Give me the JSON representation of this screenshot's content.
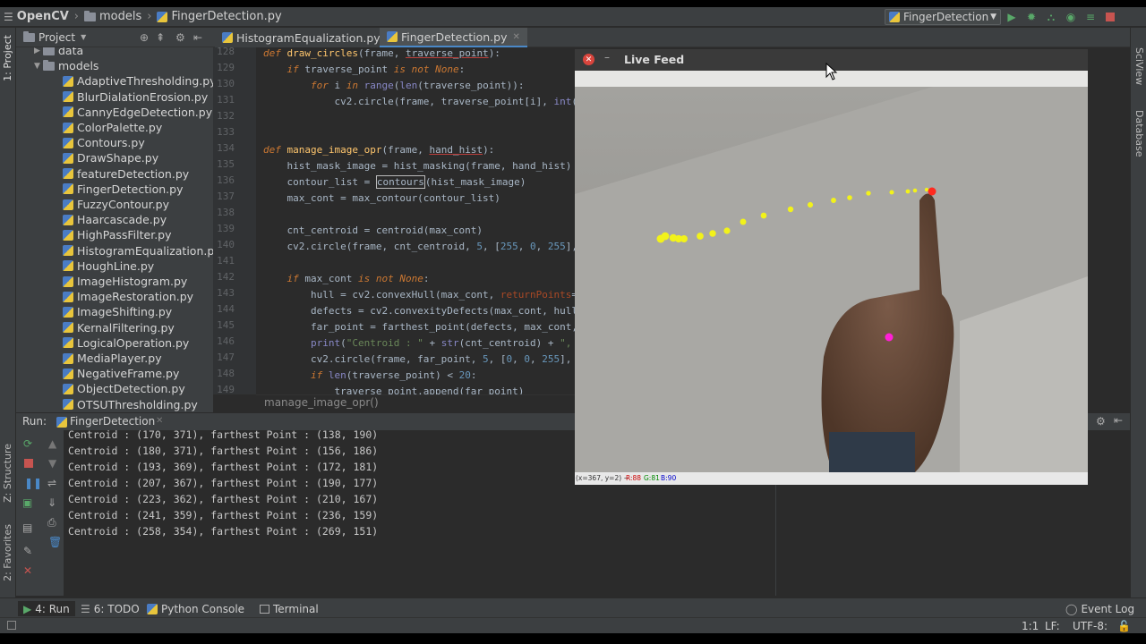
{
  "navbar": {
    "crumbs": [
      "OpenCV",
      "models",
      "FingerDetection.py"
    ],
    "run_config": "FingerDetection"
  },
  "left_strip": {
    "project_tab": "1: Project",
    "structure_tab": "Z: Structure",
    "favorites_tab": "2: Favorites"
  },
  "right_strip": {
    "sciview_tab": "SciView",
    "database_tab": "Database"
  },
  "project_panel": {
    "title": "Project",
    "items": [
      {
        "label": "data",
        "kind": "folder",
        "indent": 1
      },
      {
        "label": "models",
        "kind": "folder",
        "indent": 1
      },
      {
        "label": "AdaptiveThresholding.py",
        "kind": "file"
      },
      {
        "label": "BlurDialationErosion.py",
        "kind": "file"
      },
      {
        "label": "CannyEdgeDetection.py",
        "kind": "file"
      },
      {
        "label": "ColorPalette.py",
        "kind": "file"
      },
      {
        "label": "Contours.py",
        "kind": "file"
      },
      {
        "label": "DrawShape.py",
        "kind": "file"
      },
      {
        "label": "featureDetection.py",
        "kind": "file"
      },
      {
        "label": "FingerDetection.py",
        "kind": "file"
      },
      {
        "label": "FuzzyContour.py",
        "kind": "file"
      },
      {
        "label": "Haarcascade.py",
        "kind": "file"
      },
      {
        "label": "HighPassFilter.py",
        "kind": "file"
      },
      {
        "label": "HistogramEqualization.py",
        "kind": "file"
      },
      {
        "label": "HoughLine.py",
        "kind": "file"
      },
      {
        "label": "ImageHistogram.py",
        "kind": "file"
      },
      {
        "label": "ImageRestoration.py",
        "kind": "file"
      },
      {
        "label": "ImageShifting.py",
        "kind": "file"
      },
      {
        "label": "KernalFiltering.py",
        "kind": "file"
      },
      {
        "label": "LogicalOperation.py",
        "kind": "file"
      },
      {
        "label": "MediaPlayer.py",
        "kind": "file"
      },
      {
        "label": "NegativeFrame.py",
        "kind": "file"
      },
      {
        "label": "ObjectDetection.py",
        "kind": "file"
      },
      {
        "label": "OTSUThresholding.py",
        "kind": "file"
      }
    ]
  },
  "editor": {
    "tabs": [
      "HistogramEqualization.py",
      "FingerDetection.py"
    ],
    "line_numbers": [
      "128",
      "129",
      "130",
      "131",
      "132",
      "133",
      "134",
      "135",
      "136",
      "137",
      "138",
      "139",
      "140",
      "141",
      "142",
      "143",
      "144",
      "145",
      "146",
      "147",
      "148",
      "149"
    ],
    "breadcrumb": "manage_image_opr()"
  },
  "run_panel": {
    "label": "Run:",
    "tab": "FingerDetection",
    "lines": [
      "Centroid : (170, 371), farthest Point : (138, 190)",
      "Centroid : (180, 371), farthest Point : (156, 186)",
      "Centroid : (193, 369), farthest Point : (172, 181)",
      "Centroid : (207, 367), farthest Point : (190, 177)",
      "Centroid : (223, 362), farthest Point : (210, 167)",
      "Centroid : (241, 359), farthest Point : (236, 159)",
      "Centroid : (258, 354), farthest Point : (269, 151)"
    ]
  },
  "tool_tabs": {
    "run": "4: Run",
    "todo": "6: TODO",
    "python_console": "Python Console",
    "terminal": "Terminal",
    "event_log": "Event Log"
  },
  "status": {
    "position": "1:1",
    "line_sep": "LF:",
    "encoding": "UTF-8:"
  },
  "live_feed": {
    "title": "Live Feed",
    "status_coords": "(x=367, y=2) ~",
    "status_r": "R:88",
    "status_g": "G:81",
    "status_b": "B:90"
  }
}
